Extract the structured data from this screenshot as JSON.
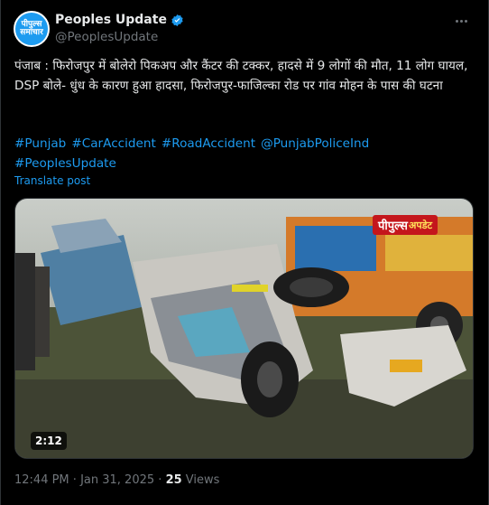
{
  "account": {
    "avatar_text": "पीपुल्स\nसमाचार",
    "display_name": "Peoples Update",
    "handle": "@PeoplesUpdate"
  },
  "tweet": {
    "text": "पंजाब : फिरोजपुर में बोलेरो पिकअप और कैंटर की टक्कर, हादसे में 9 लोगों की मौत, 11 लोग घायल, DSP बोले- धुंध के कारण हुआ हादसा, फिरोजपुर-फाजिल्का रोड पर गांव मोहन के पास की घटना",
    "hashtags": [
      "#Punjab",
      "#CarAccident",
      "#RoadAccident",
      "@PunjabPoliceInd",
      "#PeoplesUpdate"
    ],
    "translate_label": "Translate post"
  },
  "media": {
    "badge_main": "पीपुल्स",
    "badge_sub": "अपडेट",
    "duration": "2:12"
  },
  "meta": {
    "time": "12:44 PM",
    "separator": "·",
    "date": "Jan 31, 2025",
    "views_count": "25",
    "views_label": "Views"
  },
  "colors": {
    "background": "#000000",
    "text": "#e7e9ea",
    "secondary": "#71767b",
    "link": "#1d9bf0",
    "badge": "#c4161c"
  }
}
